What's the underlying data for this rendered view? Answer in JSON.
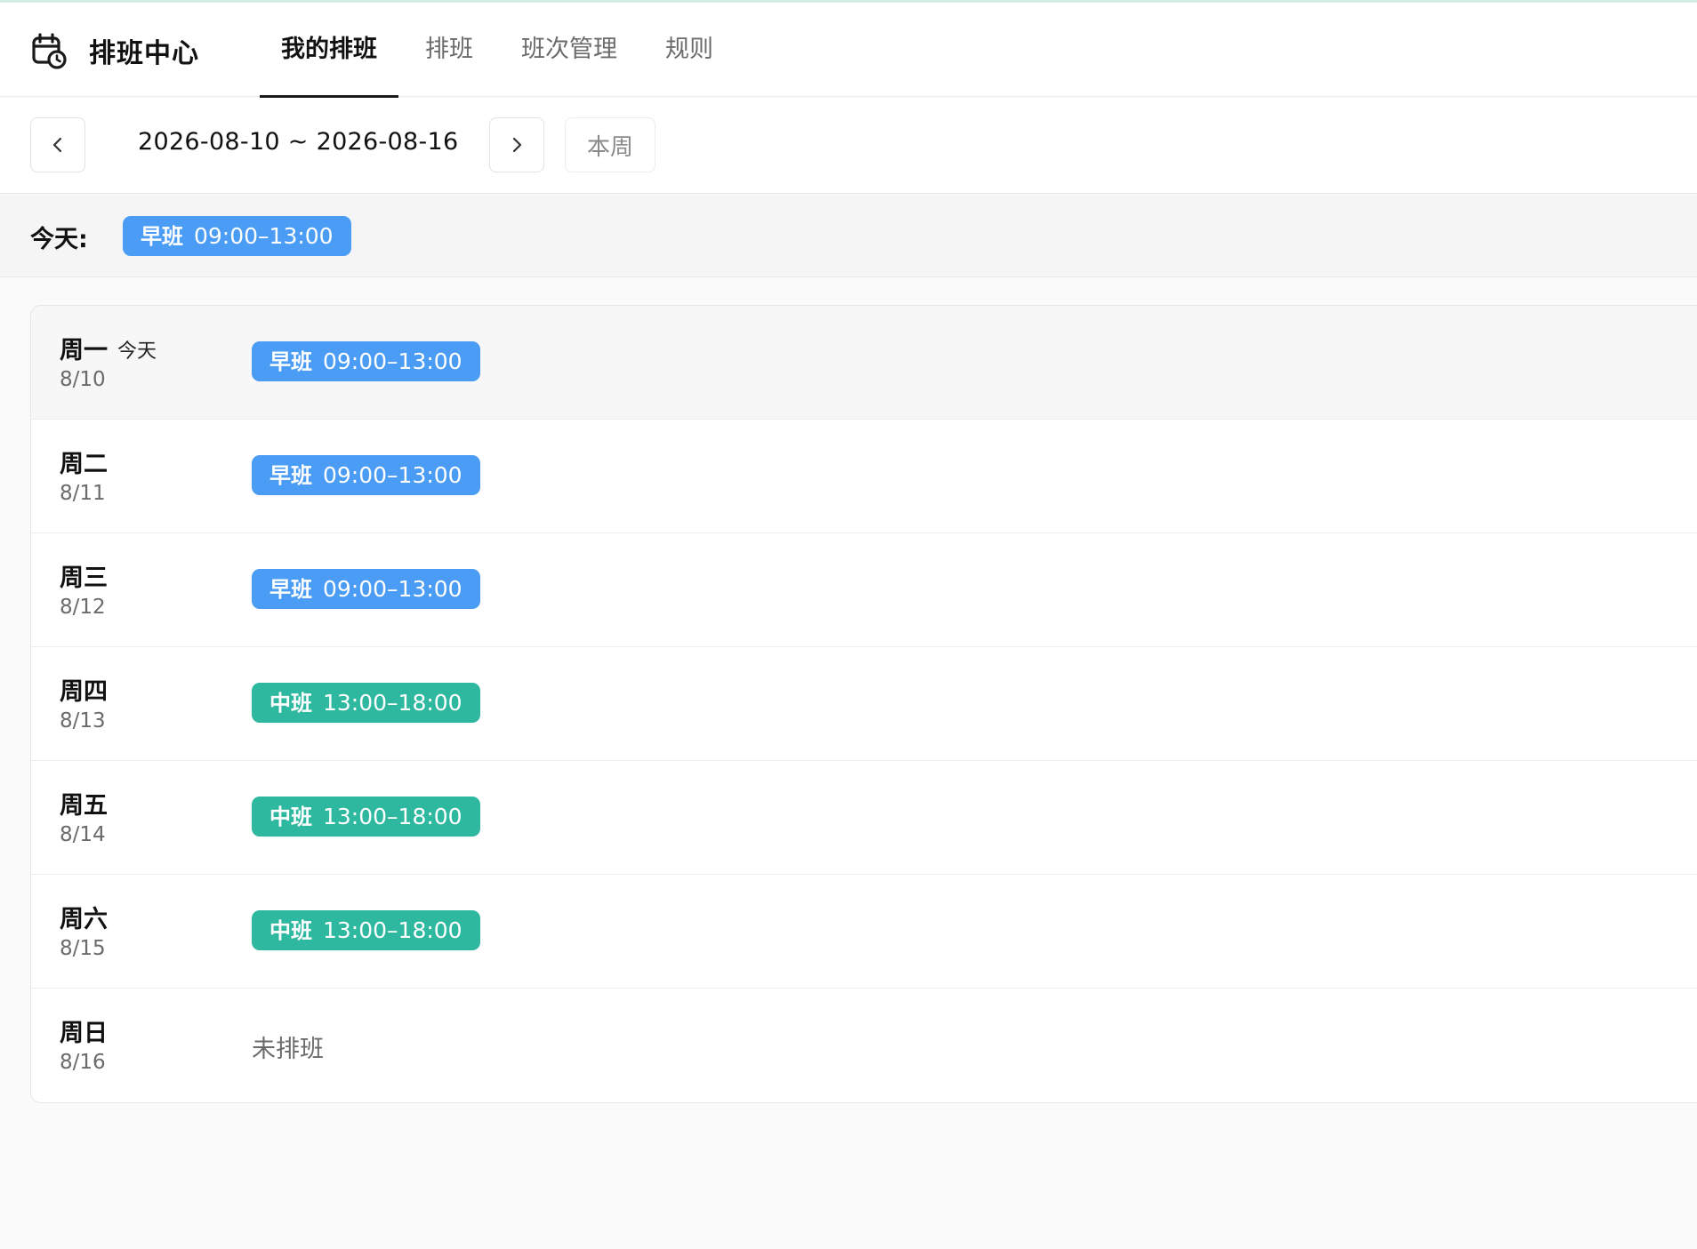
{
  "header": {
    "title": "排班中心",
    "tabs": [
      {
        "label": "我的排班",
        "active": true
      },
      {
        "label": "排班",
        "active": false
      },
      {
        "label": "班次管理",
        "active": false
      },
      {
        "label": "规则",
        "active": false
      }
    ]
  },
  "date_nav": {
    "range": "2026-08-10 ~ 2026-08-16",
    "this_week_label": "本周",
    "prev_icon": "chevron-left-icon",
    "next_icon": "chevron-right-icon"
  },
  "today": {
    "label": "今天:",
    "shift_name": "早班",
    "shift_time": "09:00–13:00"
  },
  "schedule": [
    {
      "day": "周一",
      "date": "8/10",
      "today_tag": "今天",
      "shift_name": "早班",
      "shift_time": "09:00–13:00",
      "color": "#4b9cf4"
    },
    {
      "day": "周二",
      "date": "8/11",
      "today_tag": "",
      "shift_name": "早班",
      "shift_time": "09:00–13:00",
      "color": "#4b9cf4"
    },
    {
      "day": "周三",
      "date": "8/12",
      "today_tag": "",
      "shift_name": "早班",
      "shift_time": "09:00–13:00",
      "color": "#4b9cf4"
    },
    {
      "day": "周四",
      "date": "8/13",
      "today_tag": "",
      "shift_name": "中班",
      "shift_time": "13:00–18:00",
      "color": "#2fb8a0"
    },
    {
      "day": "周五",
      "date": "8/14",
      "today_tag": "",
      "shift_name": "中班",
      "shift_time": "13:00–18:00",
      "color": "#2fb8a0"
    },
    {
      "day": "周六",
      "date": "8/15",
      "today_tag": "",
      "shift_name": "中班",
      "shift_time": "13:00–18:00",
      "color": "#2fb8a0"
    },
    {
      "day": "周日",
      "date": "8/16",
      "today_tag": "",
      "empty_text": "未排班"
    }
  ],
  "colors": {
    "early_shift": "#4b9cf4",
    "mid_shift": "#2fb8a0",
    "active_tab_underline": "#1a1a1a"
  }
}
